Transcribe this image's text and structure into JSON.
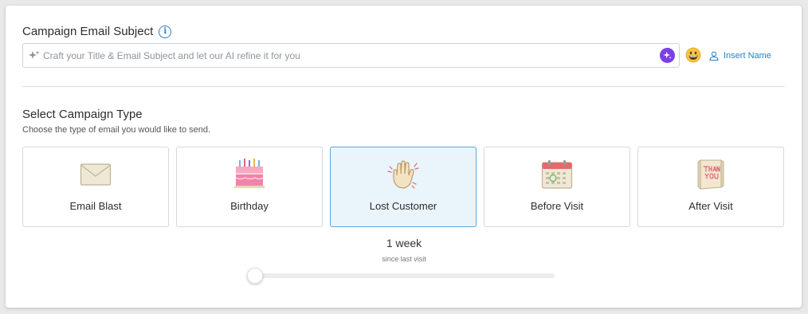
{
  "subject": {
    "label": "Campaign Email Subject",
    "info_icon": "info-icon",
    "input_placeholder": "Craft your Title & Email Subject and let our AI refine it for you",
    "input_value": "",
    "ai_button_icon": "sparkle-icon",
    "emoji_icon": "emoji-icon",
    "insert_name_label": "Insert Name"
  },
  "campaign_type": {
    "title": "Select Campaign Type",
    "subtitle": "Choose the type of email you would like to send.",
    "cards": [
      {
        "label": "Email Blast",
        "icon": "envelope-icon",
        "selected": false
      },
      {
        "label": "Birthday",
        "icon": "birthday-cake-icon",
        "selected": false
      },
      {
        "label": "Lost Customer",
        "icon": "waving-hand-icon",
        "selected": true
      },
      {
        "label": "Before Visit",
        "icon": "calendar-icon",
        "selected": false
      },
      {
        "label": "After Visit",
        "icon": "thank-you-card-icon",
        "selected": false
      }
    ]
  },
  "lost_customer": {
    "duration": "1 week",
    "duration_caption": "since last visit",
    "slider_fraction": 0.0
  },
  "colors": {
    "accent": "#2a7fc9",
    "ai_purple": "#7b3fe4",
    "selected_bg": "#eaf4fb",
    "selected_border": "#5aa7db"
  }
}
